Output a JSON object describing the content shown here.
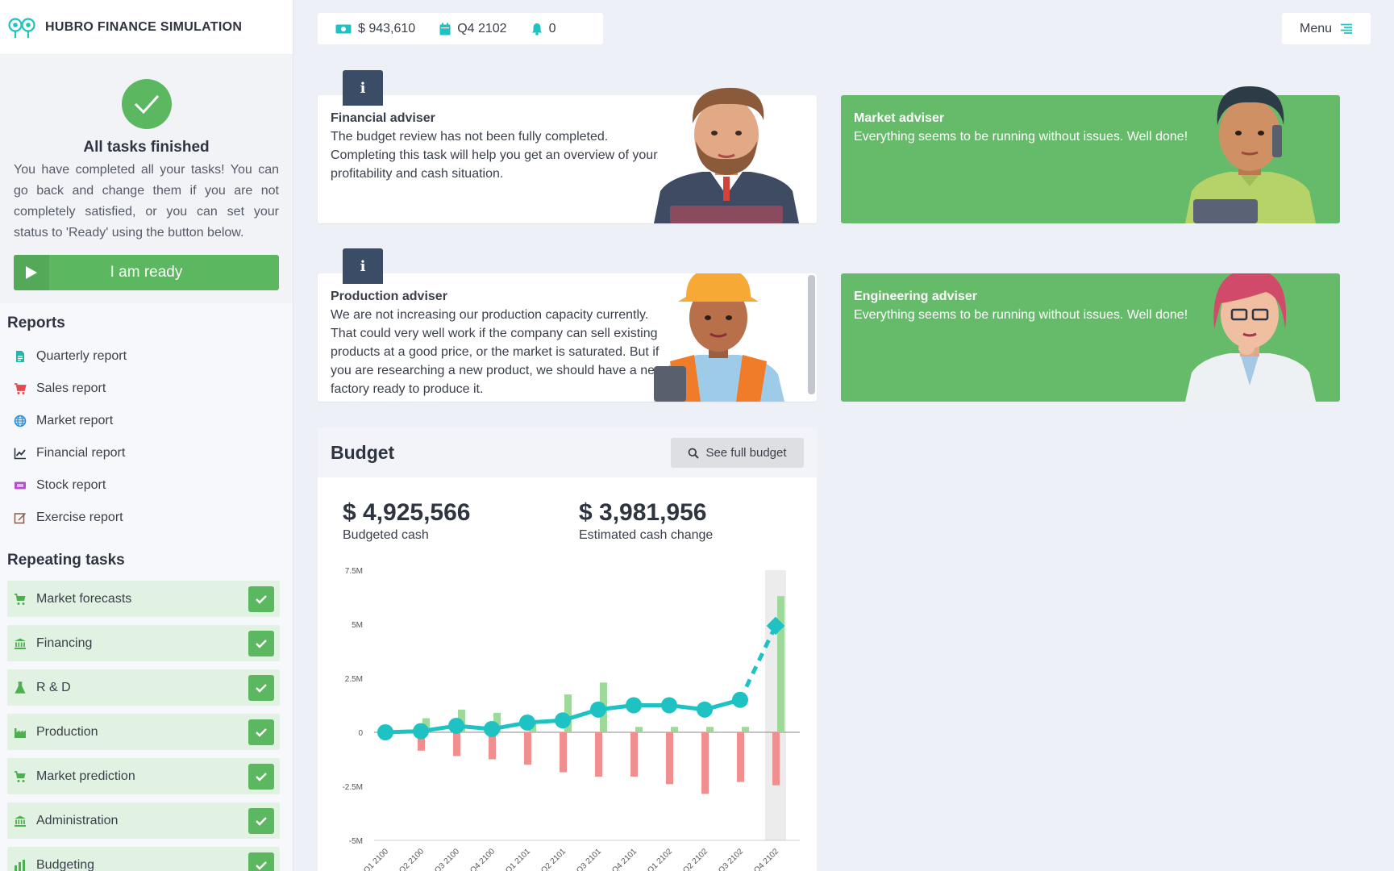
{
  "app": {
    "title": "HUBRO FINANCE SIMULATION"
  },
  "status": {
    "cash": "$ 943,610",
    "period": "Q4 2102",
    "notifications": "0"
  },
  "menu": {
    "label": "Menu"
  },
  "tasks": {
    "title": "All tasks finished",
    "text": "You have completed all your tasks! You can go back and change them if you are not completely satisfied, or you can set your status to 'Ready' using the button below.",
    "ready_label": "I am ready"
  },
  "reports": {
    "title": "Reports",
    "items": [
      {
        "label": "Quarterly report",
        "icon": "document-icon",
        "color": "#26b5a8"
      },
      {
        "label": "Sales report",
        "icon": "cart-icon",
        "color": "#e24c4c"
      },
      {
        "label": "Market report",
        "icon": "globe-icon",
        "color": "#2f8ed6"
      },
      {
        "label": "Financial report",
        "icon": "line-chart-icon",
        "color": "#2f3441"
      },
      {
        "label": "Stock report",
        "icon": "ticket-icon",
        "color": "#b34fc9"
      },
      {
        "label": "Exercise report",
        "icon": "edit-icon",
        "color": "#8a5a44"
      }
    ]
  },
  "repeating": {
    "title": "Repeating tasks",
    "items": [
      {
        "label": "Market forecasts",
        "icon": "cart-icon"
      },
      {
        "label": "Financing",
        "icon": "bank-icon"
      },
      {
        "label": "R & D",
        "icon": "flask-icon"
      },
      {
        "label": "Production",
        "icon": "factory-icon"
      },
      {
        "label": "Market prediction",
        "icon": "cart-icon"
      },
      {
        "label": "Administration",
        "icon": "bank-icon"
      },
      {
        "label": "Budgeting",
        "icon": "bar-chart-icon"
      }
    ]
  },
  "advisers": {
    "financial": {
      "name": "Financial adviser",
      "text": "The budget review has not been fully completed. Completing this task will help you get an overview of your profitability and cash situation."
    },
    "market": {
      "name": "Market adviser",
      "text": "Everything seems to be running without issues. Well done!"
    },
    "production": {
      "name": "Production adviser",
      "text": "We are not increasing our production capacity currently. That could very well work if the company can sell existing products at a good price, or the market is saturated. But if you are researching a new product, we should have a new factory ready to produce it."
    },
    "engineering": {
      "name": "Engineering adviser",
      "text": "Everything seems to be running without issues. Well done!"
    }
  },
  "budget": {
    "title": "Budget",
    "full_button": "See full budget",
    "budgeted_cash": "$ 4,925,566",
    "budgeted_cash_label": "Budgeted cash",
    "estimated_change": "$ 3,981,956",
    "estimated_change_label": "Estimated cash change"
  },
  "colors": {
    "accent": "#1ec2c2",
    "green": "#5cb860",
    "positive_bar": "#9fd99a",
    "negative_bar": "#ef8f8f"
  },
  "chart_data": {
    "type": "bar",
    "categories": [
      "Q1 2100",
      "Q2 2100",
      "Q3 2100",
      "Q4 2100",
      "Q1 2101",
      "Q2 2101",
      "Q3 2101",
      "Q4 2101",
      "Q1 2102",
      "Q2 2102",
      "Q3 2102",
      "Q4 2102"
    ],
    "yticks": [
      "7.5M",
      "5M",
      "2.5M",
      "0",
      "-2.5M",
      "-5M"
    ],
    "ylim": [
      -5000000,
      7500000
    ],
    "series": [
      {
        "kind": "bar-positive",
        "values": [
          0,
          650000,
          1050000,
          900000,
          400000,
          1750000,
          2300000,
          250000,
          250000,
          250000,
          250000,
          6300000
        ]
      },
      {
        "kind": "bar-negative",
        "values": [
          0,
          -850000,
          -1100000,
          -1250000,
          -1500000,
          -1850000,
          -2050000,
          -2050000,
          -2400000,
          -2850000,
          -2300000,
          -2450000
        ]
      },
      {
        "kind": "line",
        "values": [
          0,
          50000,
          300000,
          150000,
          450000,
          550000,
          1050000,
          1250000,
          1250000,
          1050000,
          1500000,
          4925566
        ]
      }
    ],
    "highlight": "Q4 2102"
  }
}
